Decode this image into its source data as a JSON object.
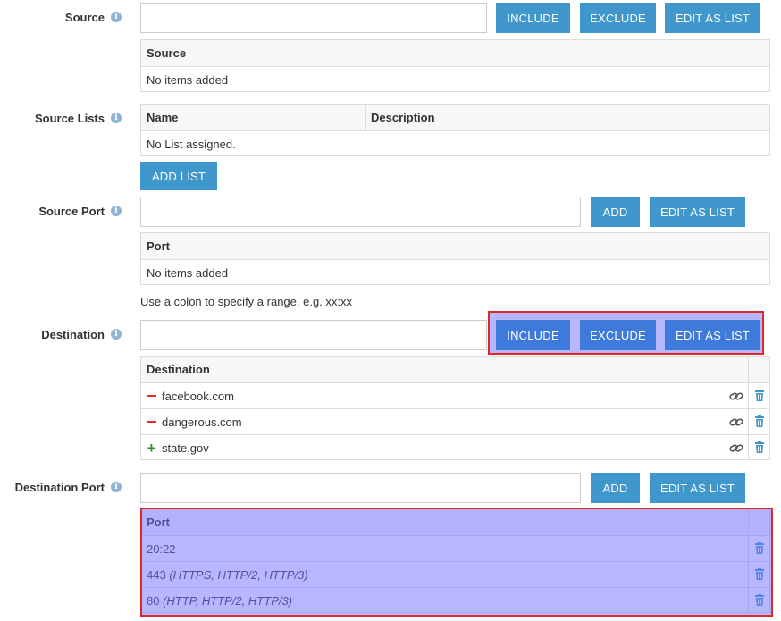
{
  "source": {
    "label": "Source",
    "input_value": "",
    "include_label": "INCLUDE",
    "exclude_label": "EXCLUDE",
    "edit_list_label": "EDIT AS LIST",
    "table_header": "Source",
    "empty_text": "No items added"
  },
  "source_lists": {
    "label": "Source Lists",
    "col_name": "Name",
    "col_description": "Description",
    "empty_text": "No List assigned.",
    "add_list_label": "ADD LIST"
  },
  "source_port": {
    "label": "Source Port",
    "input_value": "",
    "add_label": "ADD",
    "edit_list_label": "EDIT AS LIST",
    "table_header": "Port",
    "empty_text": "No items added",
    "hint": "Use a colon to specify a range, e.g. xx:xx"
  },
  "destination": {
    "label": "Destination",
    "input_value": "",
    "include_label": "INCLUDE",
    "exclude_label": "EXCLUDE",
    "edit_list_label": "EDIT AS LIST",
    "table_header": "Destination",
    "rows": [
      {
        "mode": "exclude",
        "value": "facebook.com"
      },
      {
        "mode": "exclude",
        "value": "dangerous.com"
      },
      {
        "mode": "include",
        "value": "state.gov"
      }
    ]
  },
  "destination_port": {
    "label": "Destination Port",
    "input_value": "",
    "add_label": "ADD",
    "edit_list_label": "EDIT AS LIST",
    "table_header": "Port",
    "rows": [
      {
        "port": "20:22",
        "protocols": ""
      },
      {
        "port": "443",
        "protocols": "(HTTPS, HTTP/2, HTTP/3)"
      },
      {
        "port": "80",
        "protocols": "(HTTP, HTTP/2, HTTP/3)"
      }
    ]
  },
  "colors": {
    "button": "#3f97cc",
    "button_highlight": "#3d7adb",
    "exclude_marker": "#d9312a",
    "include_marker": "#2f8a2f",
    "highlight_border": "#e0262b",
    "info_icon": "#8fb4d6",
    "trash_icon": "#3f97cc"
  },
  "icons": {
    "info": "info-icon",
    "link": "link-icon",
    "delete": "trash-icon"
  }
}
